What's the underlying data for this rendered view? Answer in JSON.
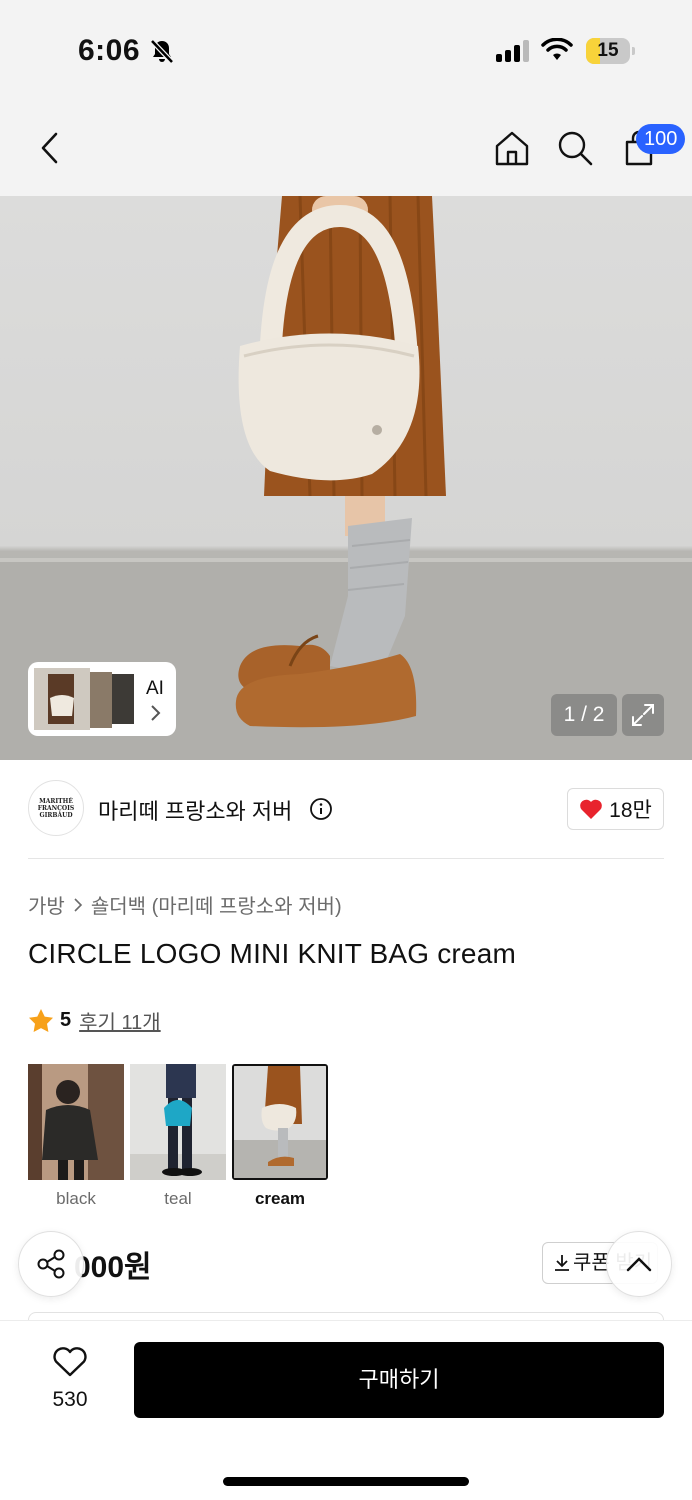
{
  "status_bar": {
    "time": "6:06",
    "battery": "15",
    "icons": [
      "bell-slash-icon",
      "signal-icon",
      "wifi-icon",
      "battery-icon"
    ]
  },
  "nav": {
    "icons": [
      "back-icon",
      "home-icon",
      "search-icon",
      "cart-icon"
    ],
    "cart_badge": "100"
  },
  "gallery": {
    "ai_label": "AI",
    "page_indicator": "1 / 2",
    "icons": [
      "expand-icon",
      "chevron-right-icon"
    ]
  },
  "brand": {
    "name": "마리떼 프랑소와 저버",
    "logo_text": "MARITHÉ FRANÇOIS GIRBAUD",
    "likes": "18만"
  },
  "breadcrumb": {
    "category": "가방",
    "subcategory": "숄더백 (마리떼 프랑소와 저버)"
  },
  "product": {
    "title": "CIRCLE LOGO MINI KNIT BAG cream",
    "rating": "5",
    "reviews": "후기 11개",
    "price_visible": "000원",
    "coupon_label": "쿠폰 받기"
  },
  "color_options": [
    {
      "label": "black",
      "selected": false
    },
    {
      "label": "teal",
      "selected": false
    },
    {
      "label": "cream",
      "selected": true
    }
  ],
  "bottom_bar": {
    "wishlist_count": "530",
    "buy_label": "구매하기"
  },
  "colors": {
    "accent_blue": "#2962ff",
    "heart_red": "#e8232d",
    "star": "#f7a11a",
    "buy_button": "#000000"
  }
}
